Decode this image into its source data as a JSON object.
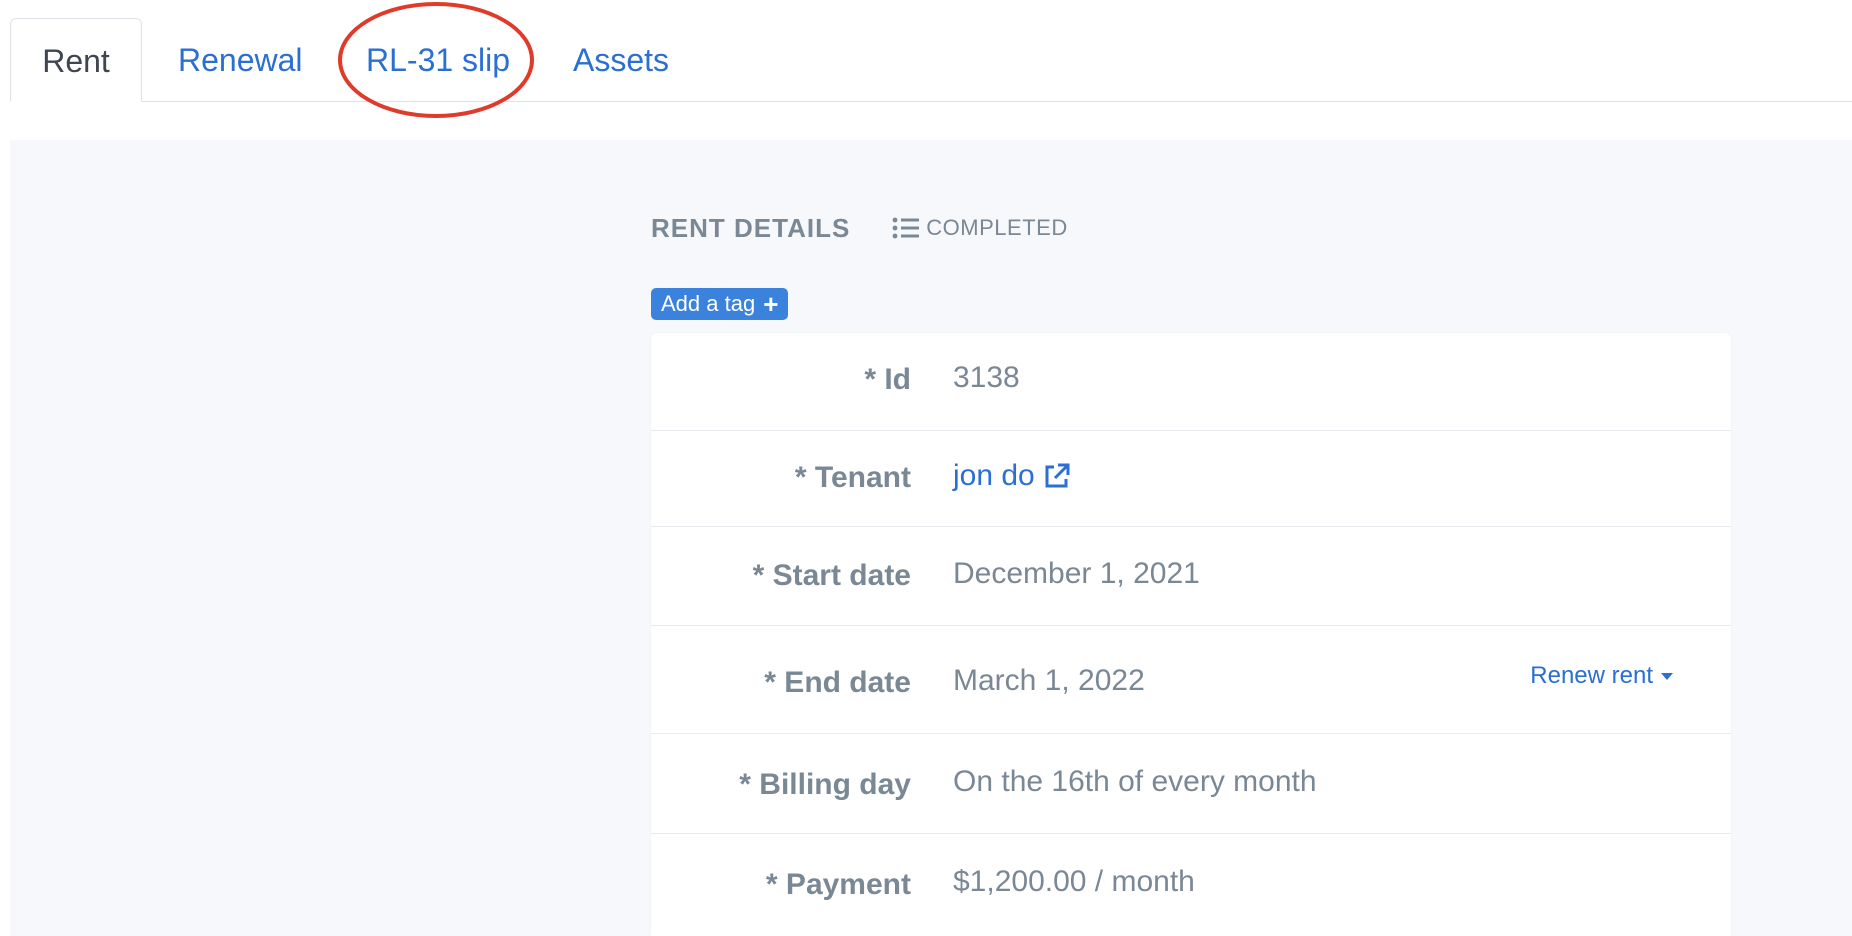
{
  "tabs": [
    {
      "label": "Rent",
      "active": true
    },
    {
      "label": "Renewal",
      "active": false
    },
    {
      "label": "RL-31 slip",
      "active": false
    },
    {
      "label": "Assets",
      "active": false
    }
  ],
  "annotation": {
    "target": "RL-31 slip",
    "color": "#e03a2a"
  },
  "section": {
    "title": "RENT DETAILS",
    "status": "COMPLETED",
    "status_icon": "list-icon"
  },
  "add_tag": {
    "label": "Add a tag",
    "icon": "plus-icon"
  },
  "details": {
    "id": {
      "label": "* Id",
      "value": "3138"
    },
    "tenant": {
      "label": "* Tenant",
      "value": "jon do",
      "icon": "external-link-icon"
    },
    "start_date": {
      "label": "* Start date",
      "value": "December 1, 2021"
    },
    "end_date": {
      "label": "* End date",
      "value": "March 1, 2022",
      "action": "Renew rent"
    },
    "billing_day": {
      "label": "* Billing day",
      "value": "On the 16th of every month"
    },
    "payment": {
      "label": "* Payment",
      "value": "$1,200.00 / month"
    }
  },
  "colors": {
    "link": "#2a6fd1",
    "muted_text": "#7a8795",
    "button_bg": "#3b82dd",
    "panel_bg": "#f7f8fb"
  }
}
